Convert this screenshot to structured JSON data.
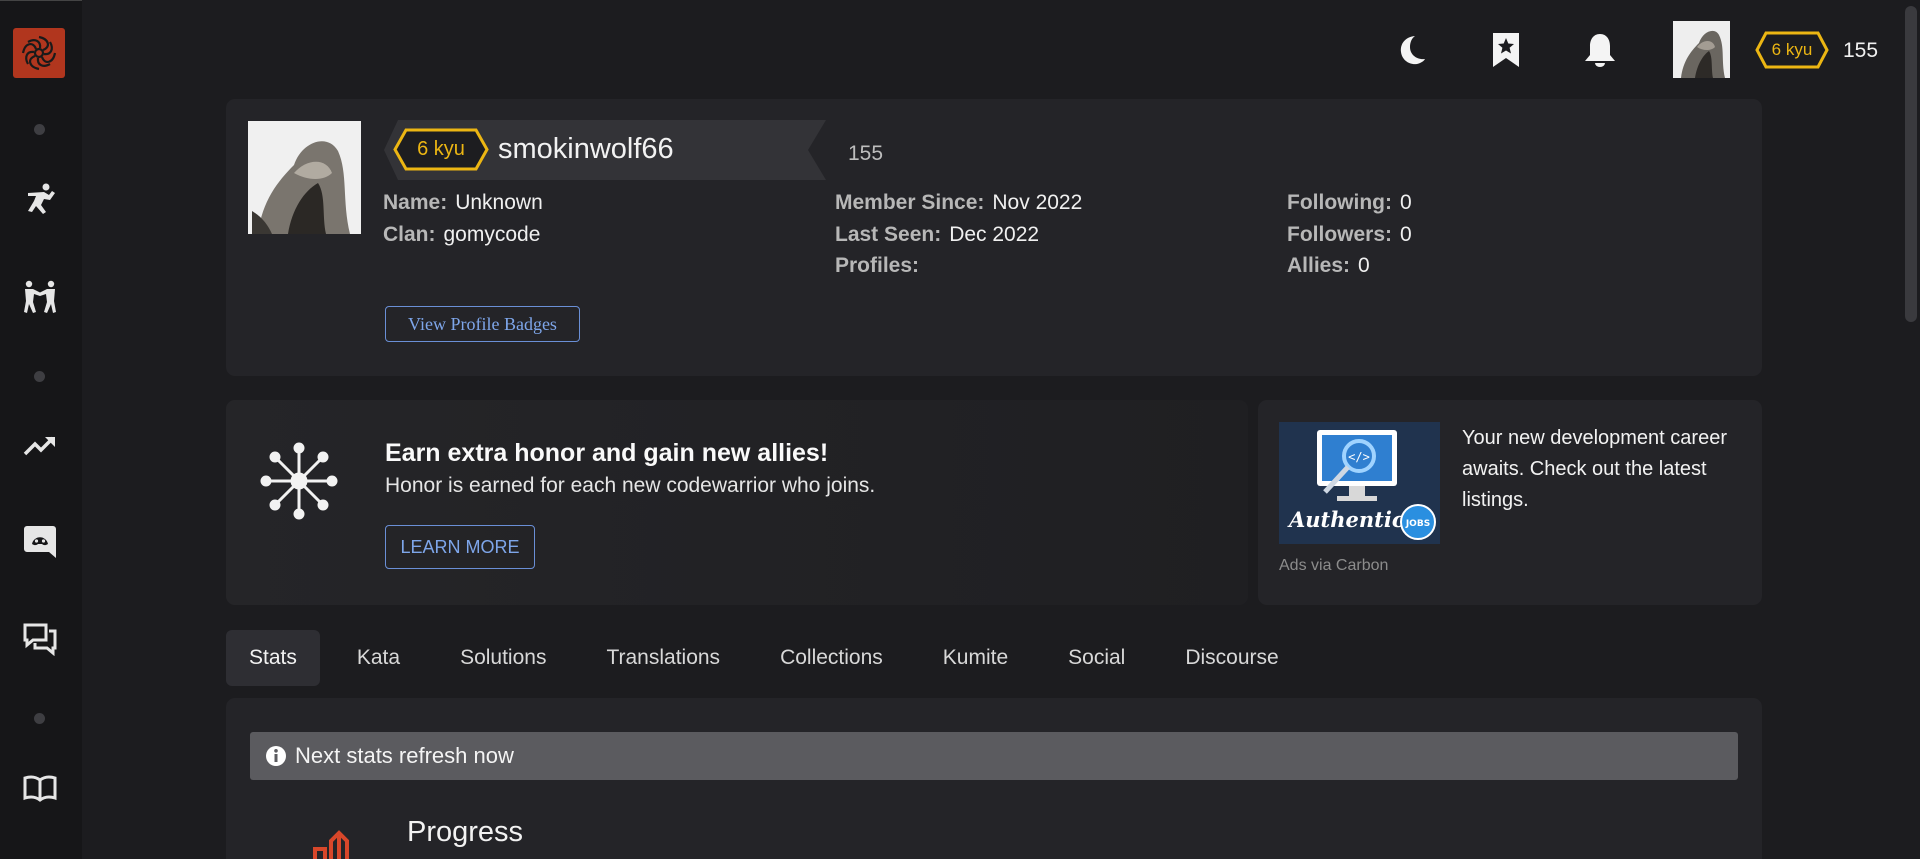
{
  "sidebar": {
    "items": [
      {
        "name": "kata-practice",
        "icon": "martial-arts-kick-icon"
      },
      {
        "name": "kumite",
        "icon": "sparring-icon"
      },
      {
        "name": "leaderboard",
        "icon": "trending-up-icon"
      },
      {
        "name": "discord",
        "icon": "discord-icon"
      },
      {
        "name": "discourse",
        "icon": "chat-bubbles-icon"
      },
      {
        "name": "docs",
        "icon": "book-icon"
      }
    ]
  },
  "topbar": {
    "icons": [
      "moon-icon",
      "bookmark-star-icon",
      "bell-icon"
    ],
    "rank": "6 kyu",
    "honor": "155"
  },
  "profile": {
    "rank": "6 kyu",
    "username": "smokinwolf66",
    "honor": "155",
    "name_label": "Name:",
    "name_value": "Unknown",
    "clan_label": "Clan:",
    "clan_value": "gomycode",
    "member_since_label": "Member Since:",
    "member_since_value": "Nov 2022",
    "last_seen_label": "Last Seen:",
    "last_seen_value": "Dec 2022",
    "profiles_label": "Profiles:",
    "following_label": "Following:",
    "following_value": "0",
    "followers_label": "Followers:",
    "followers_value": "0",
    "allies_label": "Allies:",
    "allies_value": "0",
    "badges_button": "View Profile Badges"
  },
  "promo": {
    "title": "Earn extra honor and gain new allies!",
    "subtitle": "Honor is earned for each new codewarrior who joins.",
    "button": "LEARN MORE"
  },
  "ad": {
    "text": "Your new development career awaits. Check out the latest listings.",
    "via": "Ads via Carbon",
    "image_brand": "Authentic",
    "image_badge": "JOBS"
  },
  "tabs": [
    "Stats",
    "Kata",
    "Solutions",
    "Translations",
    "Collections",
    "Kumite",
    "Social",
    "Discourse"
  ],
  "stats": {
    "refresh_notice": "Next stats refresh now",
    "progress_title": "Progress"
  },
  "colors": {
    "background": "#1c1c1f",
    "card": "#242428",
    "rank_yellow": "#ecb613",
    "brand_red": "#b1361e",
    "link_blue": "#7ea6ea"
  }
}
